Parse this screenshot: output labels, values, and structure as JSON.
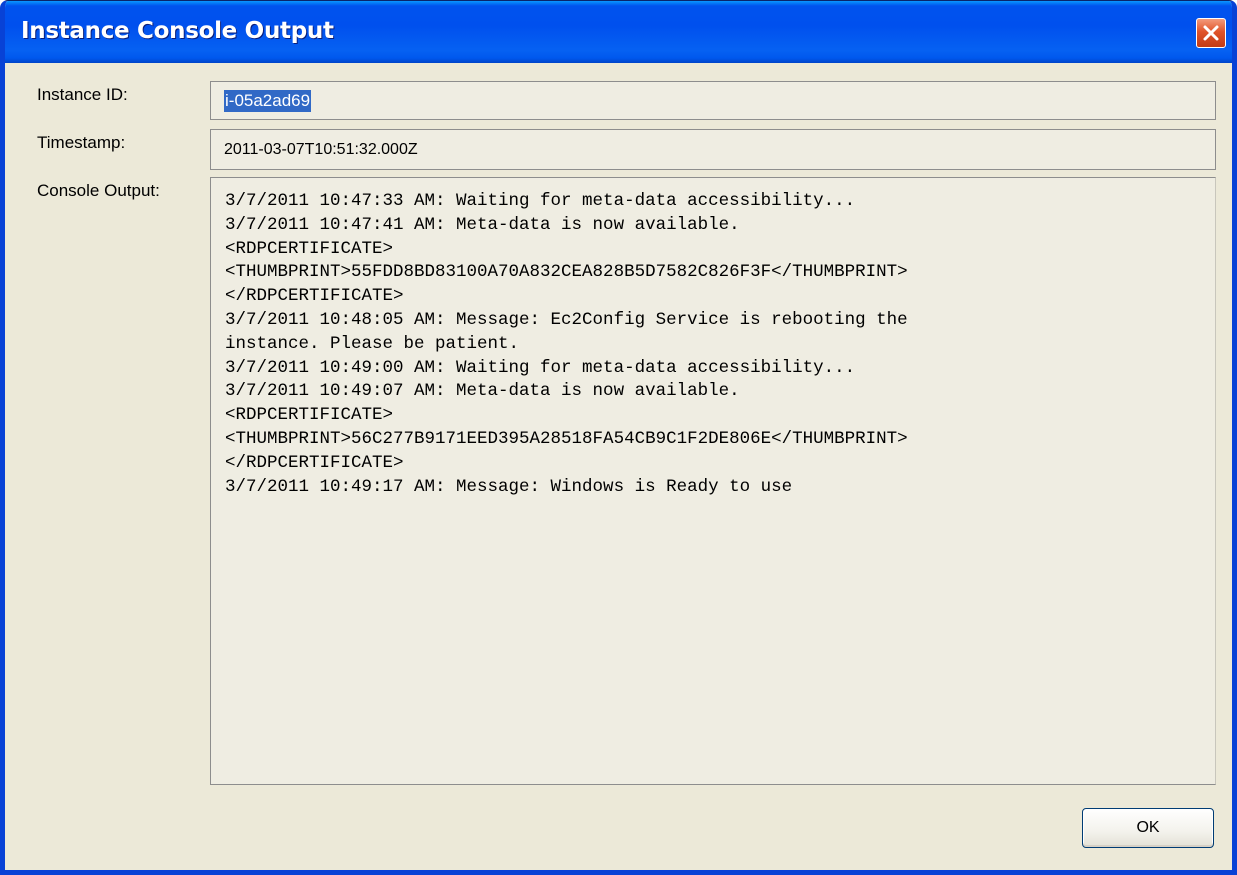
{
  "window": {
    "title": "Instance Console Output"
  },
  "form": {
    "instance_id_label": "Instance ID:",
    "instance_id_value": "i-05a2ad69",
    "timestamp_label": "Timestamp:",
    "timestamp_value": "2011-03-07T10:51:32.000Z",
    "console_label": "Console Output:",
    "console_lines": [
      "3/7/2011 10:47:33 AM: Waiting for meta-data accessibility...",
      "3/7/2011 10:47:41 AM: Meta-data is now available.",
      "<RDPCERTIFICATE>",
      "<THUMBPRINT>55FDD8BD83100A70A832CEA828B5D7582C826F3F</THUMBPRINT>",
      "</RDPCERTIFICATE>",
      "3/7/2011 10:48:05 AM: Message: Ec2Config Service is rebooting the",
      "instance. Please be patient.",
      "3/7/2011 10:49:00 AM: Waiting for meta-data accessibility...",
      "3/7/2011 10:49:07 AM: Meta-data is now available.",
      "<RDPCERTIFICATE>",
      "<THUMBPRINT>56C277B9171EED395A28518FA54CB9C1F2DE806E</THUMBPRINT>",
      "</RDPCERTIFICATE>",
      "3/7/2011 10:49:17 AM: Message: Windows is Ready to use"
    ]
  },
  "buttons": {
    "ok_label": "OK"
  },
  "icons": {
    "close": "close-icon"
  },
  "colors": {
    "titlebar": "#0054E3",
    "selection": "#3169C6",
    "dialog_background": "#ECE9D8",
    "close_button": "#E0542A"
  }
}
